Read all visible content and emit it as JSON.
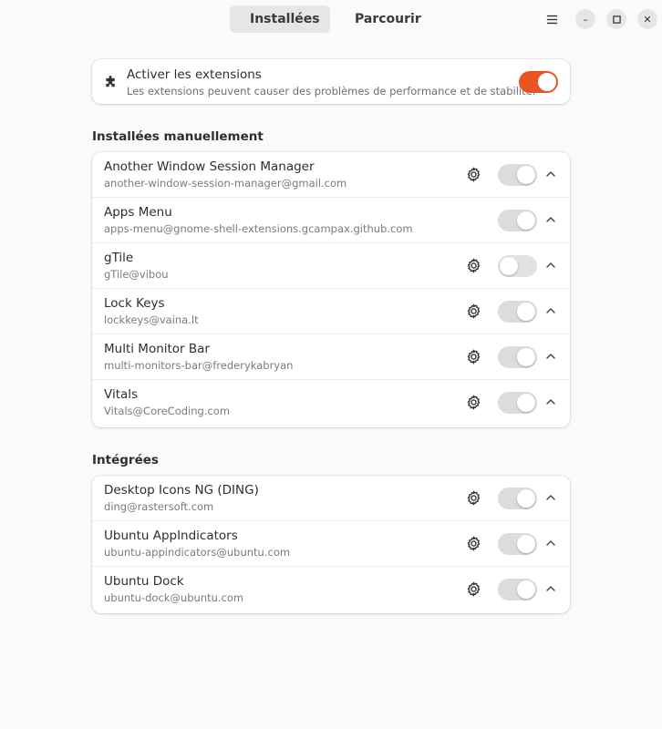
{
  "header": {
    "tabs": [
      {
        "label": "Installées",
        "active": true,
        "icon": "puzzle-icon"
      },
      {
        "label": "Parcourir",
        "active": false,
        "icon": "globe-icon"
      }
    ],
    "window_controls": [
      "menu-icon",
      "minimize-icon",
      "maximize-icon",
      "close-icon"
    ],
    "minimize_glyph": "–",
    "close_glyph": "✕"
  },
  "master": {
    "title": "Activer les extensions",
    "subtitle": "Les extensions peuvent causer des problèmes de performance et de stabilité.",
    "enabled": true,
    "accent": "#e95420"
  },
  "sections": {
    "manual": {
      "label": "Installées manuellement",
      "items": [
        {
          "name": "Another Window Session Manager",
          "uuid": "another-window-session-manager@gmail.com",
          "has_settings": true,
          "enabled": true
        },
        {
          "name": "Apps Menu",
          "uuid": "apps-menu@gnome-shell-extensions.gcampax.github.com",
          "has_settings": false,
          "enabled": true
        },
        {
          "name": "gTile",
          "uuid": "gTile@vibou",
          "has_settings": true,
          "enabled": false
        },
        {
          "name": "Lock Keys",
          "uuid": "lockkeys@vaina.lt",
          "has_settings": true,
          "enabled": true
        },
        {
          "name": "Multi Monitor Bar",
          "uuid": "multi-monitors-bar@frederykabryan",
          "has_settings": true,
          "enabled": true
        },
        {
          "name": "Vitals",
          "uuid": "Vitals@CoreCoding.com",
          "has_settings": true,
          "enabled": true
        }
      ]
    },
    "builtin": {
      "label": "Intégrées",
      "items": [
        {
          "name": "Desktop Icons NG (DING)",
          "uuid": "ding@rastersoft.com",
          "has_settings": true,
          "enabled": true
        },
        {
          "name": "Ubuntu AppIndicators",
          "uuid": "ubuntu-appindicators@ubuntu.com",
          "has_settings": true,
          "enabled": true
        },
        {
          "name": "Ubuntu Dock",
          "uuid": "ubuntu-dock@ubuntu.com",
          "has_settings": true,
          "enabled": true
        }
      ]
    }
  }
}
